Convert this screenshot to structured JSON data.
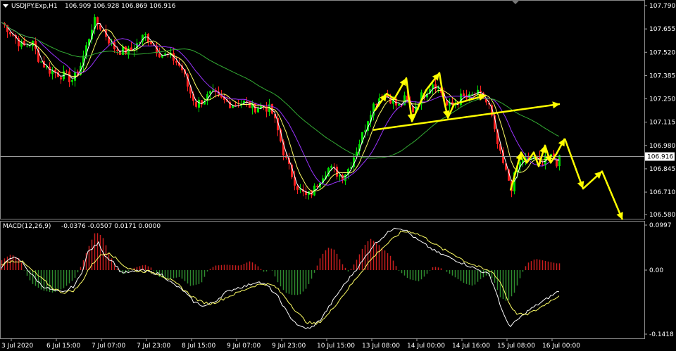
{
  "header": {
    "symbol": "USDJPY.Exp,H1",
    "ohlc": "106.909 106.928 106.869 106.916"
  },
  "macd_header": {
    "title": "MACD(12,26,9)",
    "values": "-0.0376 -0.0507 0.0171 0.0000"
  },
  "price_axis": {
    "ticks": [
      "107.790",
      "107.655",
      "107.520",
      "107.385",
      "107.250",
      "107.115",
      "106.980",
      "106.845",
      "106.710",
      "106.580"
    ],
    "current": "106.916"
  },
  "macd_axis": {
    "ticks": [
      "0.0997",
      "0.00",
      "-0.1418"
    ]
  },
  "time_axis": {
    "labels": [
      "3 Jul 2020",
      "6 Jul 15:00",
      "7 Jul 07:00",
      "7 Jul 23:00",
      "8 Jul 15:00",
      "9 Jul 07:00",
      "9 Jul 23:00",
      "10 Jul 15:00",
      "13 Jul 08:00",
      "14 Jul 00:00",
      "14 Jul 16:00",
      "15 Jul 08:00",
      "16 Jul 00:00"
    ]
  },
  "colors": {
    "background": "#000000",
    "bull": "#00e000",
    "bear": "#ff2020",
    "ma_fast": "#ffffff",
    "ma_mid": "#ffff66",
    "ma_slow": "#9933ff",
    "ma_long": "#33aa33",
    "macd_pos": "#c81e1e",
    "macd_neg": "#2e8b2e",
    "arrows": "#ffff00"
  },
  "chart_data": [
    {
      "type": "candlestick",
      "title": "USDJPY.Exp,H1",
      "ylim": [
        106.58,
        107.79
      ],
      "close_path": [
        [
          0,
          107.7
        ],
        [
          10,
          107.66
        ],
        [
          22,
          107.6
        ],
        [
          32,
          107.55
        ],
        [
          45,
          107.58
        ],
        [
          55,
          107.48
        ],
        [
          68,
          107.42
        ],
        [
          80,
          107.4
        ],
        [
          92,
          107.38
        ],
        [
          103,
          107.36
        ],
        [
          112,
          107.42
        ],
        [
          122,
          107.55
        ],
        [
          132,
          107.7
        ],
        [
          140,
          107.68
        ],
        [
          150,
          107.62
        ],
        [
          160,
          107.55
        ],
        [
          170,
          107.53
        ],
        [
          182,
          107.52
        ],
        [
          195,
          107.57
        ],
        [
          205,
          107.62
        ],
        [
          215,
          107.58
        ],
        [
          225,
          107.52
        ],
        [
          235,
          107.5
        ],
        [
          247,
          107.48
        ],
        [
          258,
          107.42
        ],
        [
          268,
          107.3
        ],
        [
          278,
          107.22
        ],
        [
          290,
          107.25
        ],
        [
          300,
          107.28
        ],
        [
          315,
          107.24
        ],
        [
          330,
          107.22
        ],
        [
          345,
          107.23
        ],
        [
          360,
          107.2
        ],
        [
          375,
          107.21
        ],
        [
          385,
          107.18
        ],
        [
          395,
          107.05
        ],
        [
          405,
          106.9
        ],
        [
          415,
          106.8
        ],
        [
          425,
          106.72
        ],
        [
          435,
          106.68
        ],
        [
          445,
          106.72
        ],
        [
          455,
          106.8
        ],
        [
          465,
          106.85
        ],
        [
          475,
          106.83
        ],
        [
          485,
          106.8
        ],
        [
          495,
          106.85
        ],
        [
          505,
          106.95
        ],
        [
          515,
          107.05
        ],
        [
          525,
          107.18
        ],
        [
          535,
          107.25
        ],
        [
          545,
          107.28
        ],
        [
          555,
          107.25
        ],
        [
          565,
          107.2
        ],
        [
          575,
          107.25
        ],
        [
          585,
          107.18
        ],
        [
          595,
          107.25
        ],
        [
          605,
          107.3
        ],
        [
          615,
          107.35
        ],
        [
          625,
          107.3
        ],
        [
          635,
          107.2
        ],
        [
          645,
          107.22
        ],
        [
          655,
          107.26
        ],
        [
          665,
          107.25
        ],
        [
          675,
          107.28
        ],
        [
          685,
          107.26
        ],
        [
          695,
          107.2
        ],
        [
          702,
          107.05
        ],
        [
          710,
          106.92
        ],
        [
          718,
          106.82
        ],
        [
          726,
          106.74
        ],
        [
          734,
          106.85
        ],
        [
          742,
          106.9
        ],
        [
          750,
          106.88
        ],
        [
          758,
          106.92
        ],
        [
          766,
          106.86
        ],
        [
          774,
          106.93
        ],
        [
          782,
          106.9
        ],
        [
          790,
          106.88
        ],
        [
          795,
          106.92
        ]
      ],
      "moving_averages": [
        {
          "role": "ma_fast",
          "color": "#ffffff"
        },
        {
          "role": "ma_mid",
          "color": "#ffff66"
        },
        {
          "role": "ma_slow",
          "color": "#9933ff"
        },
        {
          "role": "ma_long",
          "color": "#33aa33"
        }
      ],
      "horizontal_line": 106.916,
      "annotations": {
        "zigzag_1": [
          [
            532,
            107.18
          ],
          [
            549,
            107.28
          ],
          [
            560,
            107.25
          ],
          [
            577,
            107.37
          ],
          [
            585,
            107.12
          ],
          [
            605,
            107.3
          ],
          [
            624,
            107.4
          ],
          [
            630,
            107.25
          ],
          [
            636,
            107.14
          ],
          [
            645,
            107.22
          ],
          [
            690,
            107.27
          ]
        ],
        "trendline": [
          [
            530,
            107.07
          ],
          [
            795,
            107.22
          ]
        ],
        "zigzag_2": [
          [
            725,
            106.72
          ],
          [
            740,
            106.94
          ],
          [
            748,
            106.88
          ],
          [
            758,
            106.94
          ],
          [
            765,
            106.86
          ],
          [
            774,
            106.98
          ],
          [
            782,
            106.88
          ],
          [
            790,
            106.93
          ],
          [
            802,
            107.02
          ]
        ],
        "projection": [
          [
            802,
            107.02
          ],
          [
            828,
            106.73
          ],
          [
            855,
            106.83
          ],
          [
            884,
            106.55
          ]
        ]
      }
    },
    {
      "type": "bar",
      "title": "MACD(12,26,9)",
      "ylim": [
        -0.1418,
        0.0997
      ],
      "hist_path": [
        [
          0,
          0.02
        ],
        [
          15,
          0.035
        ],
        [
          28,
          0.025
        ],
        [
          35,
          -0.005
        ],
        [
          45,
          -0.03
        ],
        [
          60,
          -0.045
        ],
        [
          75,
          -0.05
        ],
        [
          90,
          -0.04
        ],
        [
          105,
          -0.02
        ],
        [
          115,
          0.01
        ],
        [
          125,
          0.05
        ],
        [
          135,
          0.085
        ],
        [
          145,
          0.075
        ],
        [
          155,
          0.035
        ],
        [
          165,
          0.005
        ],
        [
          175,
          -0.01
        ],
        [
          190,
          0.005
        ],
        [
          205,
          0.012
        ],
        [
          215,
          0.005
        ],
        [
          225,
          -0.015
        ],
        [
          240,
          -0.02
        ],
        [
          255,
          -0.015
        ],
        [
          270,
          -0.035
        ],
        [
          285,
          -0.03
        ],
        [
          295,
          0.0
        ],
        [
          305,
          0.01
        ],
        [
          320,
          0.012
        ],
        [
          340,
          0.01
        ],
        [
          355,
          0.02
        ],
        [
          365,
          0.01
        ],
        [
          375,
          -0.005
        ],
        [
          385,
          0.002
        ],
        [
          395,
          -0.03
        ],
        [
          405,
          -0.05
        ],
        [
          415,
          -0.055
        ],
        [
          425,
          -0.055
        ],
        [
          435,
          -0.04
        ],
        [
          445,
          -0.01
        ],
        [
          455,
          0.03
        ],
        [
          465,
          0.05
        ],
        [
          475,
          0.045
        ],
        [
          485,
          0.015
        ],
        [
          495,
          -0.005
        ],
        [
          505,
          0.02
        ],
        [
          515,
          0.05
        ],
        [
          525,
          0.07
        ],
        [
          535,
          0.06
        ],
        [
          545,
          0.045
        ],
        [
          555,
          0.03
        ],
        [
          565,
          0.0
        ],
        [
          580,
          -0.02
        ],
        [
          595,
          -0.025
        ],
        [
          605,
          -0.01
        ],
        [
          615,
          0.008
        ],
        [
          625,
          0.005
        ],
        [
          635,
          -0.005
        ],
        [
          645,
          -0.015
        ],
        [
          660,
          -0.03
        ],
        [
          672,
          -0.035
        ],
        [
          682,
          -0.02
        ],
        [
          692,
          -0.01
        ],
        [
          700,
          -0.02
        ],
        [
          710,
          -0.06
        ],
        [
          720,
          -0.07
        ],
        [
          730,
          -0.05
        ],
        [
          740,
          -0.01
        ],
        [
          748,
          0.015
        ],
        [
          760,
          0.025
        ],
        [
          775,
          0.02
        ],
        [
          790,
          0.015
        ],
        [
          795,
          0.015
        ]
      ],
      "macd_path": [
        [
          0,
          0.0
        ],
        [
          15,
          0.03
        ],
        [
          30,
          0.02
        ],
        [
          45,
          -0.01
        ],
        [
          60,
          -0.035
        ],
        [
          75,
          -0.045
        ],
        [
          90,
          -0.05
        ],
        [
          105,
          -0.035
        ],
        [
          115,
          -0.01
        ],
        [
          125,
          0.04
        ],
        [
          140,
          0.06
        ],
        [
          150,
          0.03
        ],
        [
          160,
          0.02
        ],
        [
          172,
          -0.005
        ],
        [
          185,
          -0.005
        ],
        [
          200,
          0.0
        ],
        [
          215,
          -0.005
        ],
        [
          230,
          -0.01
        ],
        [
          245,
          -0.03
        ],
        [
          260,
          -0.045
        ],
        [
          275,
          -0.07
        ],
        [
          290,
          -0.08
        ],
        [
          305,
          -0.07
        ],
        [
          320,
          -0.05
        ],
        [
          335,
          -0.04
        ],
        [
          350,
          -0.035
        ],
        [
          365,
          -0.025
        ],
        [
          380,
          -0.035
        ],
        [
          395,
          -0.06
        ],
        [
          410,
          -0.1
        ],
        [
          425,
          -0.125
        ],
        [
          440,
          -0.13
        ],
        [
          455,
          -0.11
        ],
        [
          470,
          -0.075
        ],
        [
          485,
          -0.04
        ],
        [
          500,
          -0.01
        ],
        [
          515,
          0.02
        ],
        [
          530,
          0.055
        ],
        [
          545,
          0.075
        ],
        [
          560,
          0.095
        ],
        [
          575,
          0.09
        ],
        [
          590,
          0.07
        ],
        [
          605,
          0.055
        ],
        [
          620,
          0.04
        ],
        [
          635,
          0.03
        ],
        [
          650,
          0.02
        ],
        [
          665,
          0.01
        ],
        [
          680,
          0.0
        ],
        [
          695,
          -0.01
        ],
        [
          705,
          -0.05
        ],
        [
          715,
          -0.1
        ],
        [
          725,
          -0.125
        ],
        [
          735,
          -0.11
        ],
        [
          750,
          -0.09
        ],
        [
          765,
          -0.075
        ],
        [
          780,
          -0.06
        ],
        [
          795,
          -0.045
        ]
      ],
      "signal_path": [
        [
          0,
          0.01
        ],
        [
          15,
          0.02
        ],
        [
          30,
          0.02
        ],
        [
          45,
          0.0
        ],
        [
          60,
          -0.02
        ],
        [
          75,
          -0.04
        ],
        [
          90,
          -0.05
        ],
        [
          105,
          -0.045
        ],
        [
          115,
          -0.03
        ],
        [
          125,
          0.0
        ],
        [
          140,
          0.03
        ],
        [
          155,
          0.04
        ],
        [
          165,
          0.025
        ],
        [
          180,
          0.005
        ],
        [
          195,
          -0.002
        ],
        [
          210,
          -0.003
        ],
        [
          225,
          -0.008
        ],
        [
          240,
          -0.02
        ],
        [
          255,
          -0.035
        ],
        [
          270,
          -0.055
        ],
        [
          285,
          -0.07
        ],
        [
          300,
          -0.075
        ],
        [
          315,
          -0.065
        ],
        [
          330,
          -0.055
        ],
        [
          345,
          -0.045
        ],
        [
          360,
          -0.035
        ],
        [
          375,
          -0.03
        ],
        [
          390,
          -0.035
        ],
        [
          405,
          -0.06
        ],
        [
          420,
          -0.09
        ],
        [
          435,
          -0.115
        ],
        [
          450,
          -0.12
        ],
        [
          465,
          -0.1
        ],
        [
          480,
          -0.07
        ],
        [
          495,
          -0.04
        ],
        [
          510,
          -0.01
        ],
        [
          525,
          0.02
        ],
        [
          540,
          0.045
        ],
        [
          555,
          0.065
        ],
        [
          570,
          0.085
        ],
        [
          585,
          0.085
        ],
        [
          600,
          0.075
        ],
        [
          615,
          0.06
        ],
        [
          630,
          0.045
        ],
        [
          645,
          0.035
        ],
        [
          660,
          0.02
        ],
        [
          675,
          0.01
        ],
        [
          690,
          0.0
        ],
        [
          700,
          -0.005
        ],
        [
          712,
          -0.03
        ],
        [
          722,
          -0.07
        ],
        [
          732,
          -0.095
        ],
        [
          745,
          -0.1
        ],
        [
          760,
          -0.09
        ],
        [
          775,
          -0.075
        ],
        [
          795,
          -0.055
        ]
      ]
    }
  ]
}
